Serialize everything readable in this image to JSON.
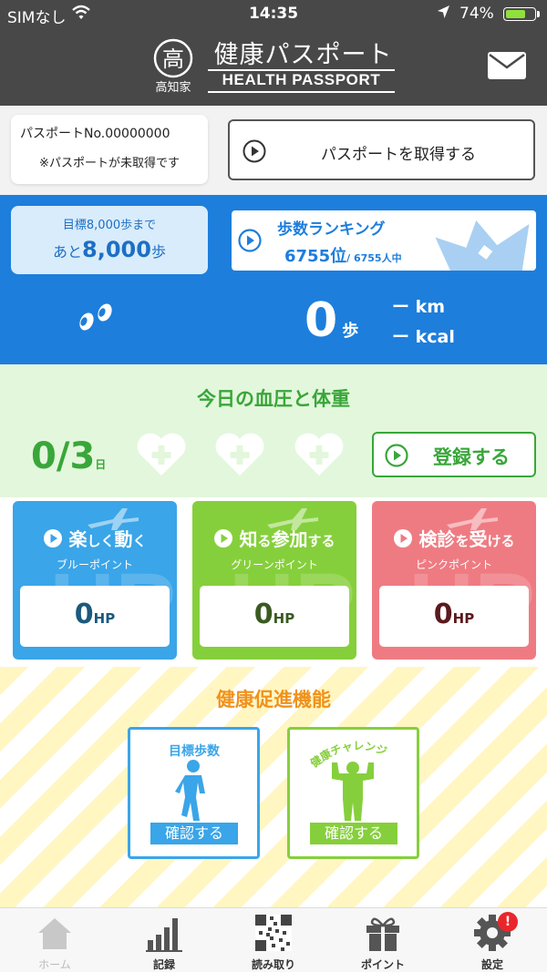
{
  "status_bar": {
    "carrier": "SIMなし",
    "time": "14:35",
    "battery_percent": "74%",
    "battery_level": 0.74
  },
  "header": {
    "logo_text": "高知家",
    "title": "健康パスポート",
    "subtitle": "HEALTH PASSPORT"
  },
  "passport": {
    "number": "パスポートNo.00000000",
    "note": "※パスポートが未取得です",
    "get_button": "パスポートを取得する"
  },
  "steps": {
    "goal_line": "目標8,000歩まで",
    "remaining_prefix": "あと",
    "remaining_value": "8,000",
    "remaining_suffix": "歩",
    "ranking_title": "歩数ランキング",
    "rank": "6755位",
    "rank_total": "/ 6755人中",
    "count": "0",
    "count_unit": "歩",
    "km": "ー km",
    "kcal": "ー kcal"
  },
  "vitals": {
    "title": "今日の血圧と体重",
    "count": "0/3",
    "count_unit": "日",
    "hearts_filled": 0,
    "hearts_total": 3,
    "register_button": "登録する"
  },
  "points": [
    {
      "title_a": "楽",
      "title_b": "しく",
      "title_c": "動",
      "title_d": "く",
      "subtitle": "ブルーポイント",
      "value": "0",
      "unit": "HP",
      "color": "#3aa5e8",
      "value_color": "#1a5a7e"
    },
    {
      "title_a": "知",
      "title_b": "る",
      "title_c": "参加",
      "title_d": "する",
      "subtitle": "グリーンポイント",
      "value": "0",
      "unit": "HP",
      "color": "#86cf3c",
      "value_color": "#3a5a22"
    },
    {
      "title_a": "検診",
      "title_b": "を",
      "title_c": "受",
      "title_d": "ける",
      "subtitle": "ピンクポイント",
      "value": "0",
      "unit": "HP",
      "color": "#ef7b82",
      "value_color": "#5a1a1e"
    }
  ],
  "promotion": {
    "title": "健康促進機能",
    "features": [
      {
        "label": "目標歩数",
        "button": "確認する",
        "color": "#3aa5e8"
      },
      {
        "label": "健康チャレンジ",
        "button": "確認する",
        "color": "#86cf3c"
      }
    ]
  },
  "tabs": [
    {
      "label": "ホーム",
      "icon": "home-icon",
      "active": false
    },
    {
      "label": "記録",
      "icon": "bar-chart-icon",
      "active": true
    },
    {
      "label": "読み取り",
      "icon": "qr-code-icon",
      "active": true
    },
    {
      "label": "ポイント",
      "icon": "gift-icon",
      "active": true
    },
    {
      "label": "設定",
      "icon": "gear-icon",
      "active": true,
      "badge": "!"
    }
  ]
}
